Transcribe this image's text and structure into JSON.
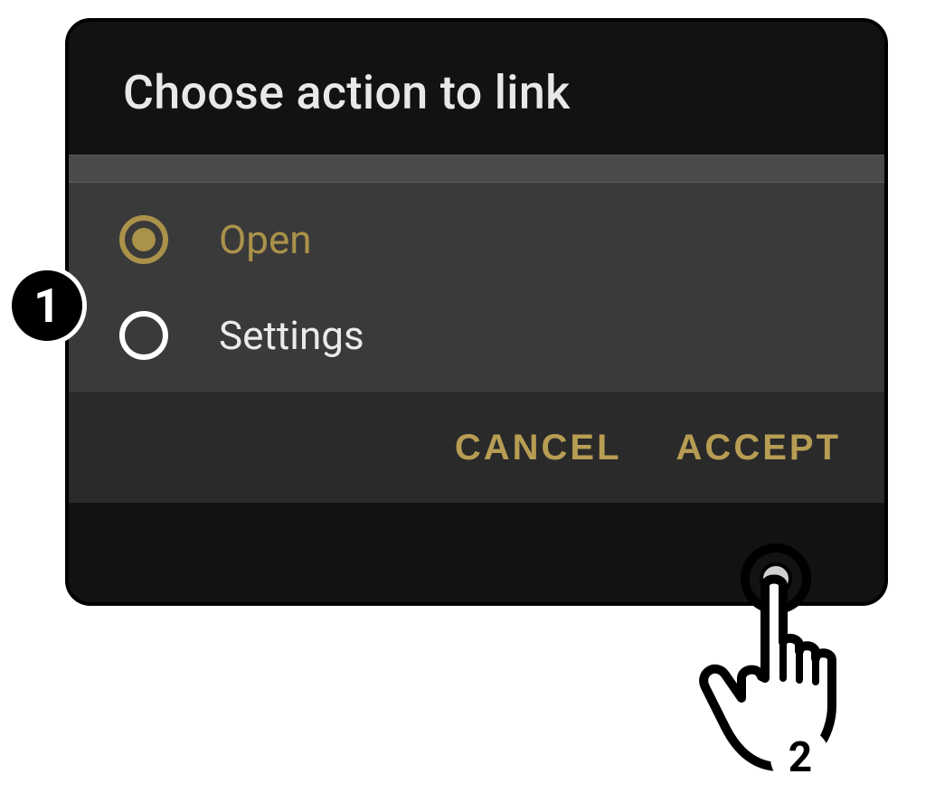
{
  "dialog": {
    "title": "Choose action to link",
    "options": [
      {
        "label": "Open",
        "selected": true
      },
      {
        "label": "Settings",
        "selected": false
      }
    ],
    "buttons": {
      "cancel": "CANCEL",
      "accept": "ACCEPT"
    }
  },
  "callouts": {
    "badge1": "1",
    "badge2": "2"
  }
}
